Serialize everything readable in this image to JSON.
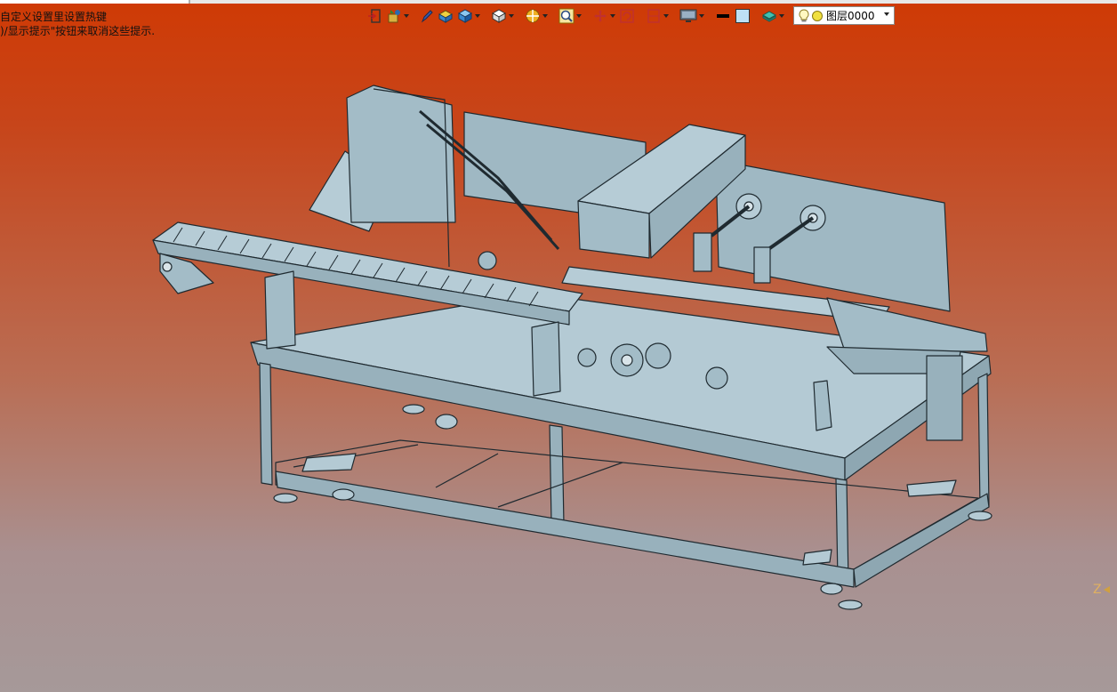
{
  "hints": {
    "line1": "自定义设置里设置热键",
    "line2": ")/显示提示\"按钮来取消这些提示."
  },
  "toolbar": {
    "items": [
      {
        "name": "exit-sketch-icon",
        "has_menu": false
      },
      {
        "name": "view-orient-icon",
        "has_menu": true
      },
      {
        "name": "pen-icon",
        "has_menu": false
      },
      {
        "name": "shaded-solid-icon",
        "has_menu": false
      },
      {
        "name": "cube-blue-icon",
        "has_menu": true
      },
      {
        "name": "cube-white-icon",
        "has_menu": true
      },
      {
        "name": "section-view-icon",
        "has_menu": true
      },
      {
        "name": "zoom-icon",
        "has_menu": true
      },
      {
        "name": "pan-icon",
        "has_menu": true
      },
      {
        "name": "rotate-icon",
        "has_menu": false
      },
      {
        "name": "standard-views-icon",
        "has_menu": true
      },
      {
        "name": "display-icon",
        "has_menu": true
      },
      {
        "name": "line-color-icon",
        "has_menu": false
      },
      {
        "name": "face-color-icon",
        "has_menu": false
      },
      {
        "name": "layer-manager-icon",
        "has_menu": true
      }
    ]
  },
  "layer": {
    "value": "图层0000"
  },
  "axis": {
    "label": "Z"
  },
  "colors": {
    "bg_top": "#cf3a05",
    "bg_bottom": "#a69999",
    "model_fill": "#a9c3cf",
    "model_stroke": "#1f2a30"
  }
}
